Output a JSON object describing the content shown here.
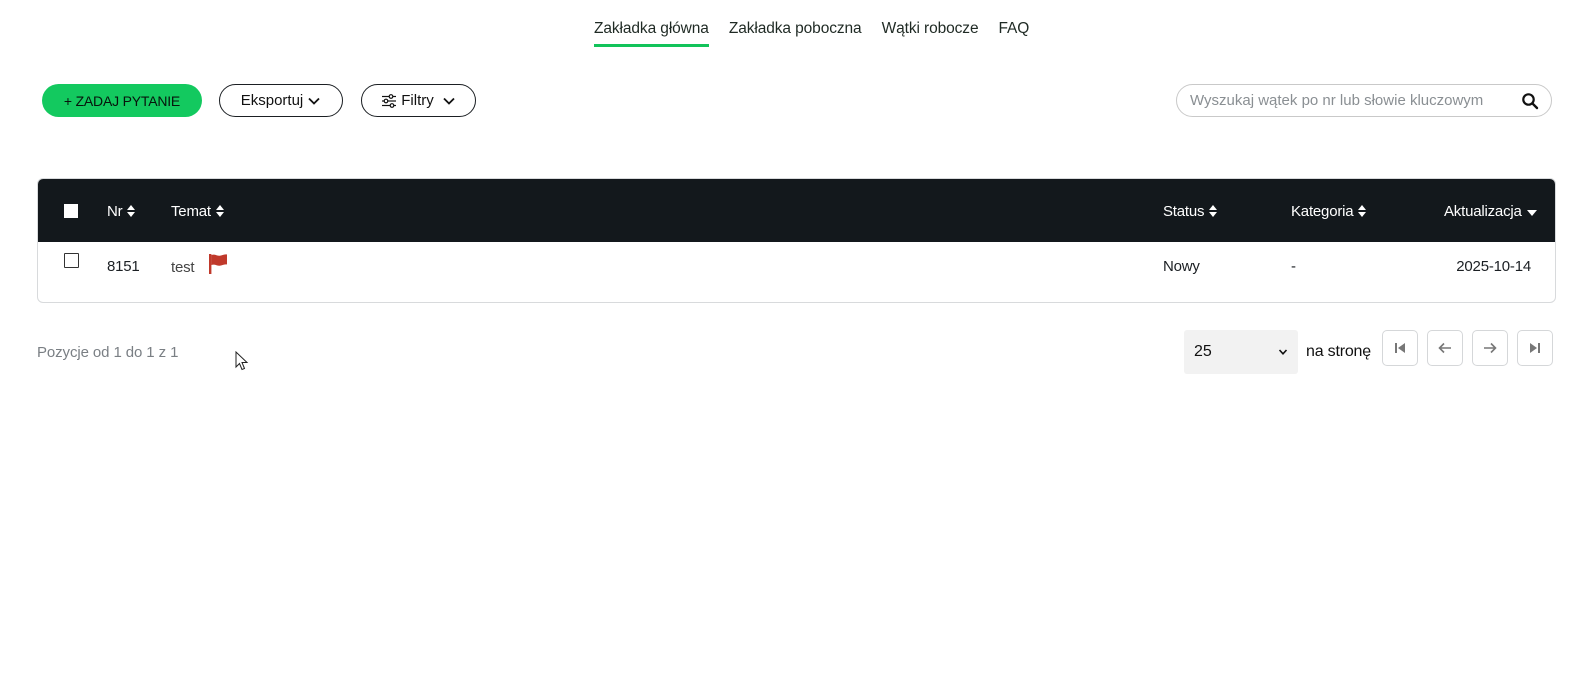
{
  "tabs": [
    {
      "label": "Zakładka główna",
      "active": true
    },
    {
      "label": "Zakładka poboczna",
      "active": false
    },
    {
      "label": "Wątki robocze",
      "active": false
    },
    {
      "label": "FAQ",
      "active": false
    }
  ],
  "toolbar": {
    "ask_label": "+ ZADAJ PYTANIE",
    "export_label": "Eksportuj",
    "filter_label": "Filtry",
    "search_placeholder": "Wyszukaj wątek po nr lub słowie kluczowym"
  },
  "table": {
    "headers": {
      "nr": "Nr",
      "temat": "Temat",
      "status": "Status",
      "kategoria": "Kategoria",
      "aktualizacja": "Aktualizacja"
    },
    "rows": [
      {
        "nr": "8151",
        "temat": "test",
        "flag": "red-flag-icon",
        "status": "Nowy",
        "kategoria": "-",
        "aktualizacja": "2025-10-14"
      }
    ]
  },
  "footer": {
    "info": "Pozycje od 1 do 1 z 1",
    "per_page_value": "25",
    "per_page_label": "na stronę"
  },
  "colors": {
    "accent": "#13c95f",
    "header_bg": "#13181c",
    "flag": "#c0392b"
  }
}
